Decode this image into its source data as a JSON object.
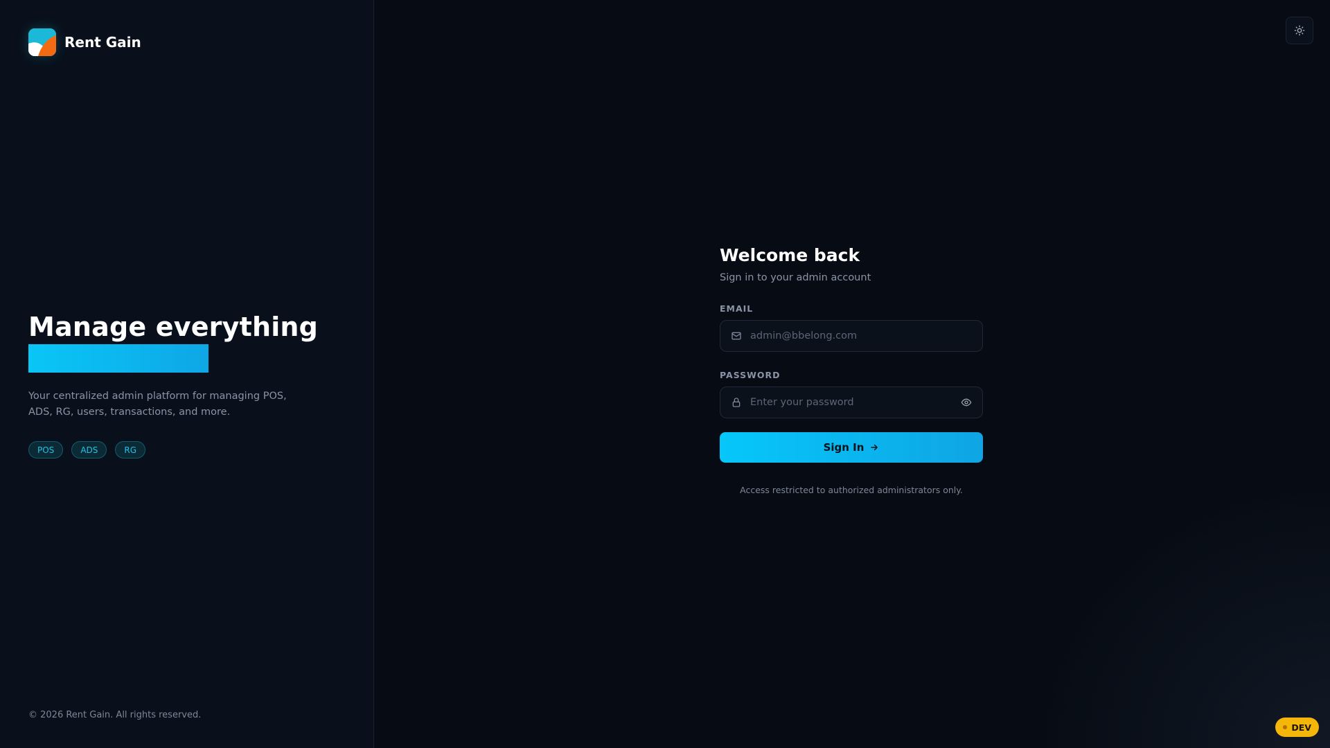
{
  "brand": {
    "name": "Rent Gain",
    "logo_icon": "rent-gain-logo"
  },
  "hero": {
    "title": "Manage everything",
    "description": "Your centralized admin platform for managing POS, ADS, RG, users, transactions, and more.",
    "tags": [
      "POS",
      "ADS",
      "RG"
    ]
  },
  "footer": {
    "copyright": "© 2026 Rent Gain. All rights reserved."
  },
  "header": {
    "theme_toggle_icon": "sun-icon"
  },
  "login": {
    "title": "Welcome back",
    "subtitle": "Sign in to your admin account",
    "email_label": "EMAIL",
    "email_placeholder": "admin@bbelong.com",
    "password_label": "PASSWORD",
    "password_placeholder": "Enter your password",
    "submit_label": "Sign In",
    "notice": "Access restricted to authorized administrators only."
  },
  "env_badge": "DEV",
  "colors": {
    "accent": "#06c7fa",
    "accent_end": "#0fa5e4",
    "background": "#070c14",
    "badge": "#f5b60a"
  }
}
